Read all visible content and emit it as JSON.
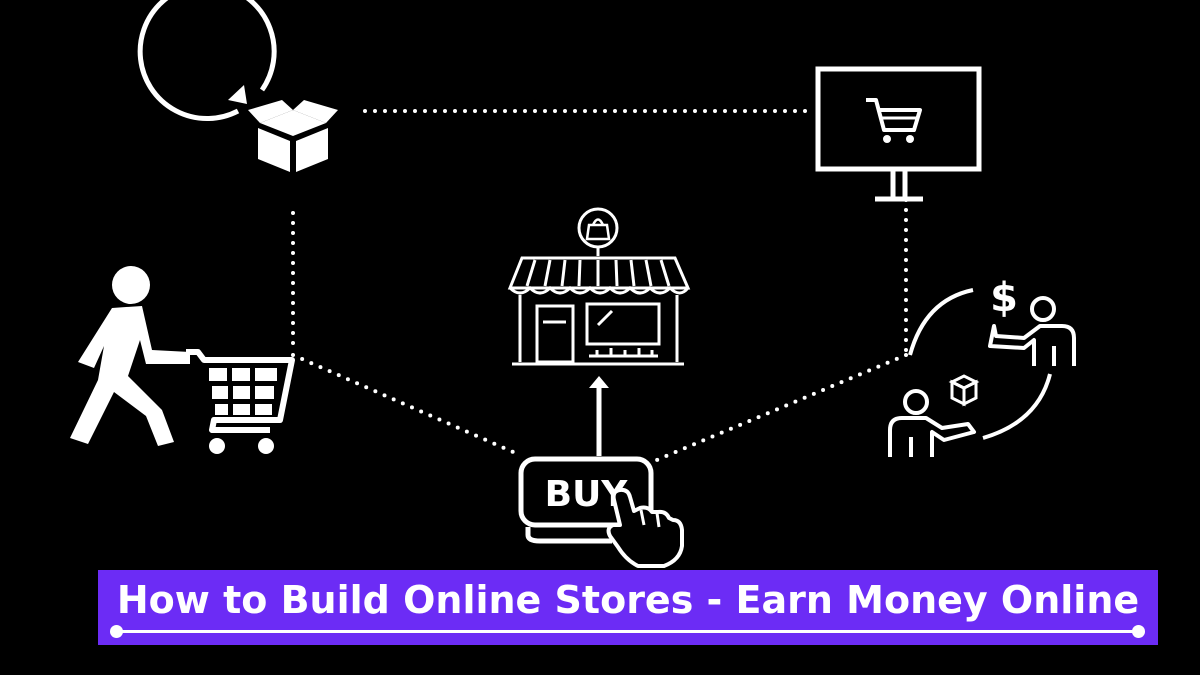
{
  "banner": {
    "title": "How to Build Online Stores - Earn Money Online",
    "background": "#6c2cf5",
    "text_color": "#ffffff"
  },
  "buy_button": {
    "label": "BUY"
  },
  "colors": {
    "background": "#000000",
    "line": "#ffffff"
  },
  "icons": [
    "package-refresh-icon",
    "monitor-cart-icon",
    "shopper-with-cart-icon",
    "online-store-icon",
    "shopping-bag-pin-icon",
    "buy-button-click-icon",
    "payment-exchange-icon"
  ]
}
